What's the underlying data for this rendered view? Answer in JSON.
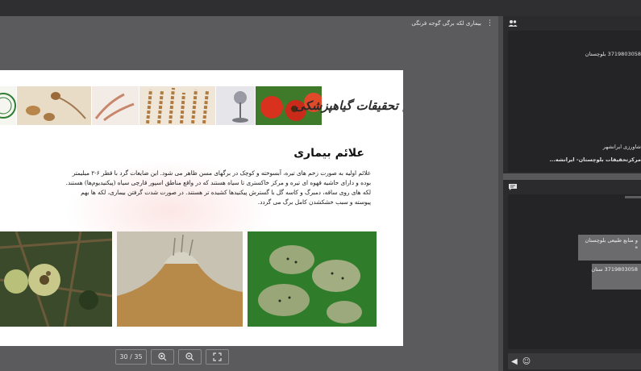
{
  "presentation": {
    "title": "بیماری لکه برگی گوجه فرنگی",
    "slide": {
      "banner_title": "بخش تحقیقات گیاهپزشکی",
      "heading": "علائم بیماری",
      "paragraph_lines": [
        "علائم اولیه به صورت زخم های تیره، آبسوخته و کوچک در برگهای مسن ظاهر می شود. این ضایعات گرد با قطر ۶-۲ میلیمتر",
        "بوده و دارای حاشیه قهوه ای تیره و مرکز خاکستری تا سیاه هستند که در واقع مناطق اسپور قارچی سیاه (پیکنیدیوم‌ها) هستند.",
        "لکه های روی ساقه، دمبرگ و کاسه گل با گسترش پیکنیدها کشیده تر هستند. در صورت شدت گرفتن بیماری، لکه ها بهم",
        "پیوسته و سبب خشکشدن کامل برگ می گردد."
      ]
    },
    "controls": {
      "page_indicator": "30 / 35",
      "zoom_in_icon": "zoom-in-icon",
      "zoom_out_icon": "zoom-out-icon",
      "fullscreen_icon": "fullscreen-icon"
    }
  },
  "users_panel": {
    "icon": "users-icon",
    "entries": [
      "3719803058 بلوچستان",
      "شاورزی ایرانشهر",
      "مرکزتحقیقات بلوچستان- ایرانشه..."
    ]
  },
  "chat_panel": {
    "icon": "chat-icon",
    "messages": [
      {
        "text": "و منابع طبیعی بلوچستان",
        "extra": "ه"
      },
      {
        "text": "3719803058 ستان"
      }
    ],
    "input_icons": [
      "send-icon",
      "emoji-icon"
    ]
  }
}
